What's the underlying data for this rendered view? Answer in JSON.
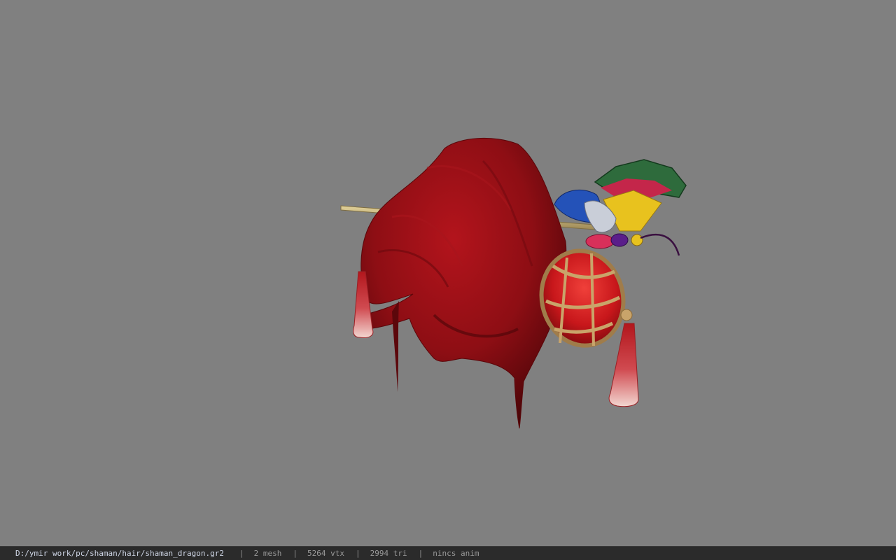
{
  "status": {
    "file_path": "D:/ymir work/pc/shaman/hair/shaman_dragon.gr2",
    "separator": "|",
    "mesh_count": "2 mesh",
    "vertex_count": "5264 vtx",
    "triangle_count": "2994 tri",
    "anim_status": "nincs anim"
  },
  "colors": {
    "viewport_background": "#808080",
    "status_bar_background": "#2b2b2b",
    "hair_red": "#8e0e14",
    "lantern_red": "#c8171b",
    "tassel_pink": "#e8b5b5",
    "hairpin_tan": "#c6b279",
    "butterfly_green": "#2e6b3c",
    "butterfly_yellow": "#e8c21e",
    "butterfly_blue": "#2452b8"
  }
}
